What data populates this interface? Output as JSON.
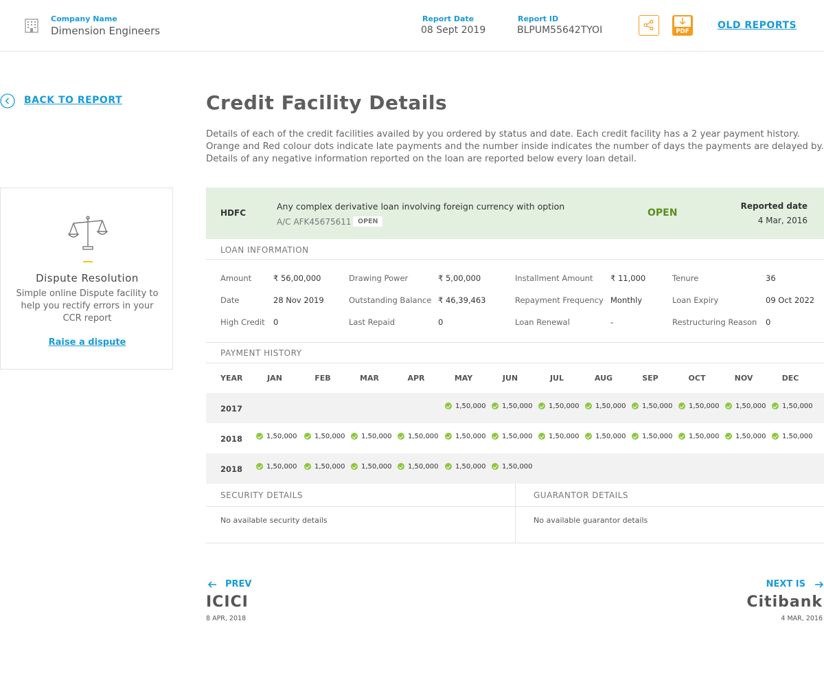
{
  "header": {
    "company_label": "Company Name",
    "company_name": "Dimension Engineers",
    "report_date_label": "Report Date",
    "report_date": "08 Sept 2019",
    "report_id_label": "Report ID",
    "report_id": "BLPUM55642TYOI",
    "old_reports": "OLD REPORTS",
    "pdf_label": "PDF"
  },
  "nav": {
    "back": "BACK TO REPORT"
  },
  "dispute": {
    "title": "Dispute Resolution",
    "text": "Simple online Dispute facility to help you rectify errors in your CCR report",
    "link": "Raise a dispute"
  },
  "page": {
    "title": "Credit Facility Details",
    "description": "Details of each of the credit facilities availed by you ordered by status and date. Each credit facility has a 2 year payment history. Orange and Red colour dots indicate late payments and the number inside indicates the number of days the payments are delayed by. Details of any negative information reported on the loan are reported below every loan detail."
  },
  "facility": {
    "bank": "HDFC",
    "name": "Any complex derivative loan involving foreign currency with option",
    "account": "A/C AFK45675611",
    "badge": "OPEN",
    "status": "OPEN",
    "reported_label": "Reported date",
    "reported_date": "4 Mar, 2016"
  },
  "loan": {
    "heading": "LOAN INFORMATION",
    "amount_k": "Amount",
    "amount_v": "₹ 56,00,000",
    "date_k": "Date",
    "date_v": "28 Nov 2019",
    "high_k": "High Credit",
    "high_v": "0",
    "dp_k": "Drawing Power",
    "dp_v": "₹ 5,00,000",
    "ob_k": "Outstanding Balance",
    "ob_v": "₹ 46,39,463",
    "lr_k": "Last Repaid",
    "lr_v": "0",
    "ia_k": "Installment Amount",
    "ia_v": "₹ 11,000",
    "rf_k": "Repayment Frequency",
    "rf_v": "Monthly",
    "ren_k": "Loan Renewal",
    "ren_v": "-",
    "ten_k": "Tenure",
    "ten_v": "36",
    "exp_k": "Loan Expiry",
    "exp_v": "09 Oct 2022",
    "rr_k": "Restructuring Reason",
    "rr_v": "0"
  },
  "payment": {
    "heading": "PAYMENT HISTORY",
    "year_label": "YEAR",
    "months": [
      "JAN",
      "FEB",
      "MAR",
      "APR",
      "MAY",
      "JUN",
      "JUL",
      "AUG",
      "SEP",
      "OCT",
      "NOV",
      "DEC"
    ],
    "rows": [
      {
        "year": "2017",
        "values": [
          "",
          "",
          "",
          "",
          "1,50,000",
          "1,50,000",
          "1,50,000",
          "1,50,000",
          "1,50,000",
          "1,50,000",
          "1,50,000",
          "1,50,000"
        ]
      },
      {
        "year": "2018",
        "values": [
          "1,50,000",
          "1,50,000",
          "1,50,000",
          "1,50,000",
          "1,50,000",
          "1,50,000",
          "1,50,000",
          "1,50,000",
          "1,50,000",
          "1,50,000",
          "1,50,000",
          "1,50,000"
        ]
      },
      {
        "year": "2018",
        "values": [
          "1,50,000",
          "1,50,000",
          "1,50,000",
          "1,50,000",
          "1,50,000",
          "1,50,000",
          "",
          "",
          "",
          "",
          "",
          ""
        ]
      }
    ]
  },
  "security": {
    "heading": "SECURITY DETAILS",
    "text": "No available security details"
  },
  "guarantor": {
    "heading": "GUARANTOR DETAILS",
    "text": "No available guarantor details"
  },
  "pager": {
    "prev_label": "PREV",
    "prev_bank": "ICICI",
    "prev_date": "8 APR, 2018",
    "next_label": "NEXT IS",
    "next_bank": "Citibank",
    "next_date": "4 MAR, 2016"
  },
  "colors": {
    "accent": "#1a9bd7",
    "green": "#8dc63f",
    "orange": "#f39c1f",
    "open_green": "#5a8f1e"
  }
}
